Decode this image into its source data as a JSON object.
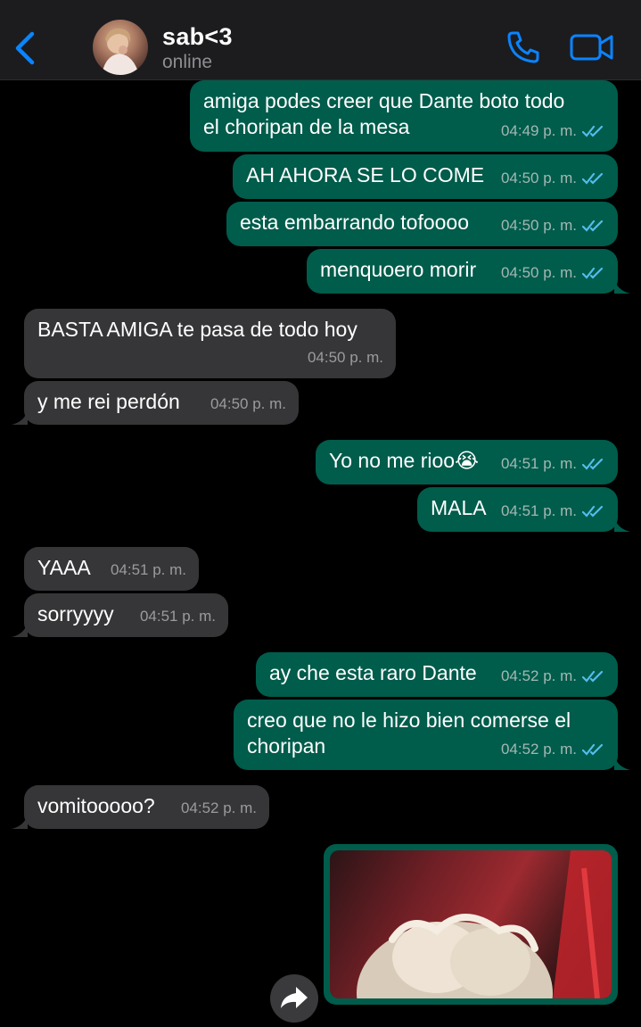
{
  "header": {
    "contact_name": "sab<3",
    "status": "online"
  },
  "messages": [
    {
      "id": "m1",
      "direction": "out",
      "lines": [
        "amiga podes creer que Dante boto todo",
        "el choripan de la mesa"
      ],
      "time": "04:49 p. m.",
      "read": true
    },
    {
      "id": "m2",
      "direction": "out",
      "lines": [
        "AH AHORA SE LO COME"
      ],
      "time": "04:50 p. m.",
      "read": true
    },
    {
      "id": "m3",
      "direction": "out",
      "lines": [
        "esta embarrando tofoooo"
      ],
      "time": "04:50 p. m.",
      "read": true
    },
    {
      "id": "m4",
      "direction": "out",
      "lines": [
        "menquoero morir"
      ],
      "time": "04:50 p. m.",
      "read": true
    },
    {
      "id": "m5",
      "direction": "in",
      "lines": [
        "BASTA AMIGA te pasa de todo hoy"
      ],
      "time": "04:50 p. m."
    },
    {
      "id": "m6",
      "direction": "in",
      "lines": [
        "y me rei perdón"
      ],
      "time": "04:50 p. m."
    },
    {
      "id": "m7",
      "direction": "out",
      "lines": [
        "Yo no me rioo😭"
      ],
      "time": "04:51 p. m.",
      "read": true
    },
    {
      "id": "m8",
      "direction": "out",
      "lines": [
        "MALA"
      ],
      "time": "04:51 p. m.",
      "read": true
    },
    {
      "id": "m9",
      "direction": "in",
      "lines": [
        "YAAA"
      ],
      "time": "04:51 p. m."
    },
    {
      "id": "m10",
      "direction": "in",
      "lines": [
        "sorryyyy"
      ],
      "time": "04:51 p. m."
    },
    {
      "id": "m11",
      "direction": "out",
      "lines": [
        "ay che esta raro Dante"
      ],
      "time": "04:52 p. m.",
      "read": true
    },
    {
      "id": "m12",
      "direction": "out",
      "lines": [
        "creo que no le hizo bien comerse el",
        "choripan"
      ],
      "time": "04:52 p. m.",
      "read": true
    },
    {
      "id": "m13",
      "direction": "in",
      "lines": [
        "vomitooooo?"
      ],
      "time": "04:52 p. m."
    }
  ],
  "colors": {
    "accent": "#0a84ff",
    "outgoing_bubble": "#005c4b",
    "incoming_bubble": "#363638",
    "read_ticks": "#53bdeb"
  },
  "icons": {
    "back": "chevron-left-icon",
    "call": "phone-icon",
    "video": "video-camera-icon",
    "forward": "forward-arrow-icon",
    "read": "double-check-icon"
  }
}
